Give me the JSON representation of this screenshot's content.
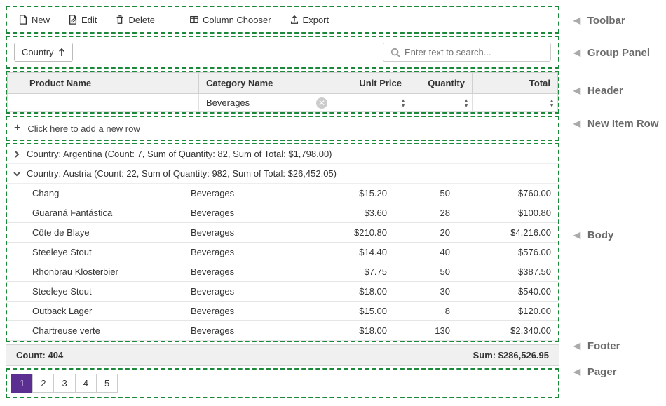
{
  "toolbar": {
    "new": "New",
    "edit": "Edit",
    "delete": "Delete",
    "column_chooser": "Column Chooser",
    "export": "Export"
  },
  "group_panel": {
    "group_by": "Country",
    "search_placeholder": "Enter text to search..."
  },
  "columns": {
    "product": "Product Name",
    "category": "Category Name",
    "price": "Unit Price",
    "qty": "Quantity",
    "total": "Total"
  },
  "filter": {
    "category": "Beverages"
  },
  "new_row": {
    "text": "Click here to add a new row"
  },
  "groups": [
    {
      "expanded": false,
      "text": "Country: Argentina (Count: 7, Sum of Quantity: 82, Sum of Total: $1,798.00)"
    },
    {
      "expanded": true,
      "text": "Country: Austria (Count: 22, Sum of Quantity: 982, Sum of Total: $26,452.05)"
    }
  ],
  "rows": [
    {
      "product": "Chang",
      "category": "Beverages",
      "price": "$15.20",
      "qty": "50",
      "total": "$760.00"
    },
    {
      "product": "Guaraná Fantástica",
      "category": "Beverages",
      "price": "$3.60",
      "qty": "28",
      "total": "$100.80"
    },
    {
      "product": "Côte de Blaye",
      "category": "Beverages",
      "price": "$210.80",
      "qty": "20",
      "total": "$4,216.00"
    },
    {
      "product": "Steeleye Stout",
      "category": "Beverages",
      "price": "$14.40",
      "qty": "40",
      "total": "$576.00"
    },
    {
      "product": "Rhönbräu Klosterbier",
      "category": "Beverages",
      "price": "$7.75",
      "qty": "50",
      "total": "$387.50"
    },
    {
      "product": "Steeleye Stout",
      "category": "Beverages",
      "price": "$18.00",
      "qty": "30",
      "total": "$540.00"
    },
    {
      "product": "Outback Lager",
      "category": "Beverages",
      "price": "$15.00",
      "qty": "8",
      "total": "$120.00"
    },
    {
      "product": "Chartreuse verte",
      "category": "Beverages",
      "price": "$18.00",
      "qty": "130",
      "total": "$2,340.00"
    }
  ],
  "footer": {
    "count": "Count: 404",
    "sum": "Sum: $286,526.95"
  },
  "pager": {
    "pages": [
      "1",
      "2",
      "3",
      "4",
      "5"
    ],
    "active": 0
  },
  "labels": {
    "toolbar": "Toolbar",
    "group_panel": "Group Panel",
    "header": "Header",
    "new_row": "New Item Row",
    "body": "Body",
    "footer": "Footer",
    "pager": "Pager"
  }
}
